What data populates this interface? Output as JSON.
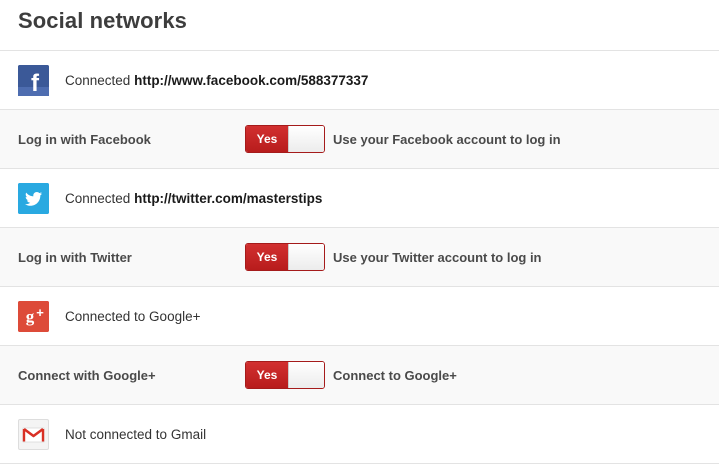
{
  "header": {
    "title": "Social networks"
  },
  "facebook": {
    "icon": "facebook-icon",
    "status_prefix": "Connected",
    "url": "http://www.facebook.com/588377337",
    "login_label": "Log in with Facebook",
    "toggle_value": "Yes",
    "description": "Use your Facebook account to log in"
  },
  "twitter": {
    "icon": "twitter-icon",
    "status_prefix": "Connected",
    "url": "http://twitter.com/masterstips",
    "login_label": "Log in with Twitter",
    "toggle_value": "Yes",
    "description": "Use your Twitter account to log in"
  },
  "google": {
    "icon": "google-plus-icon",
    "status": "Connected to Google+",
    "connect_label": "Connect with Google+",
    "toggle_value": "Yes",
    "description": "Connect to Google+"
  },
  "gmail": {
    "icon": "gmail-icon",
    "status": "Not connected to Gmail"
  },
  "colors": {
    "facebook": "#3b5998",
    "twitter": "#1da1f2",
    "google": "#dd4b39",
    "toggle_on": "#c62828"
  }
}
